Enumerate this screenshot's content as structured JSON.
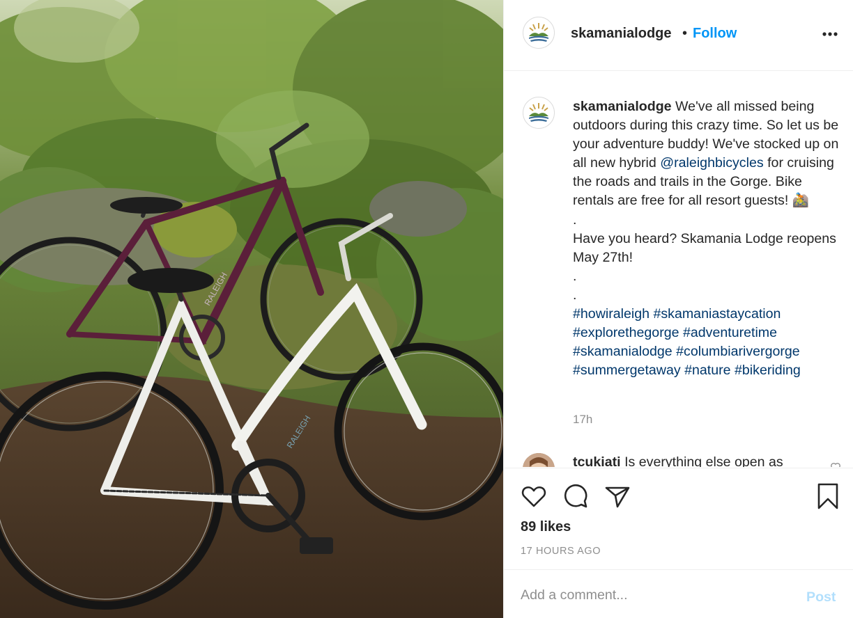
{
  "post": {
    "username": "skamanialodge",
    "header_separator": "•",
    "follow_label": "Follow",
    "more_icon": "more-horizontal-icon"
  },
  "photo": {
    "brand_text": "RALEIGH"
  },
  "caption": {
    "username": "skamanialodge",
    "line1": "We've all missed being outdoors during this crazy time. So let us be your adventure buddy! We've stocked up on all new hybrid ",
    "mention": "@raleighbicycles",
    "line2": " for cruising the roads and trails in the Gorge. Bike rentals are free for all resort guests! 🚵",
    "dot1": ".",
    "para2": "Have you heard? Skamania Lodge reopens May 27th!",
    "dot2": ".",
    "dot3": ".",
    "hashtags": [
      "#howiraleigh",
      "#skamaniastaycation",
      "#explorethegorge",
      "#adventuretime",
      "#skamanialodge",
      "#columbiarivergorge",
      "#summergetaway",
      "#nature",
      "#bikeriding"
    ],
    "age": "17h"
  },
  "reply": {
    "username": "tcukiati",
    "text": "Is everything else open as"
  },
  "actions": {
    "icons": [
      "heart-icon",
      "comment-icon",
      "share-icon",
      "bookmark-icon"
    ],
    "likes": "89 likes",
    "timestamp": "17 HOURS AGO"
  },
  "comment_box": {
    "placeholder": "Add a comment...",
    "post_label": "Post"
  },
  "colors": {
    "link": "#0095f6",
    "hashtag": "#00376b",
    "muted": "#8e8e8e",
    "post_disabled": "#b2dffc"
  }
}
